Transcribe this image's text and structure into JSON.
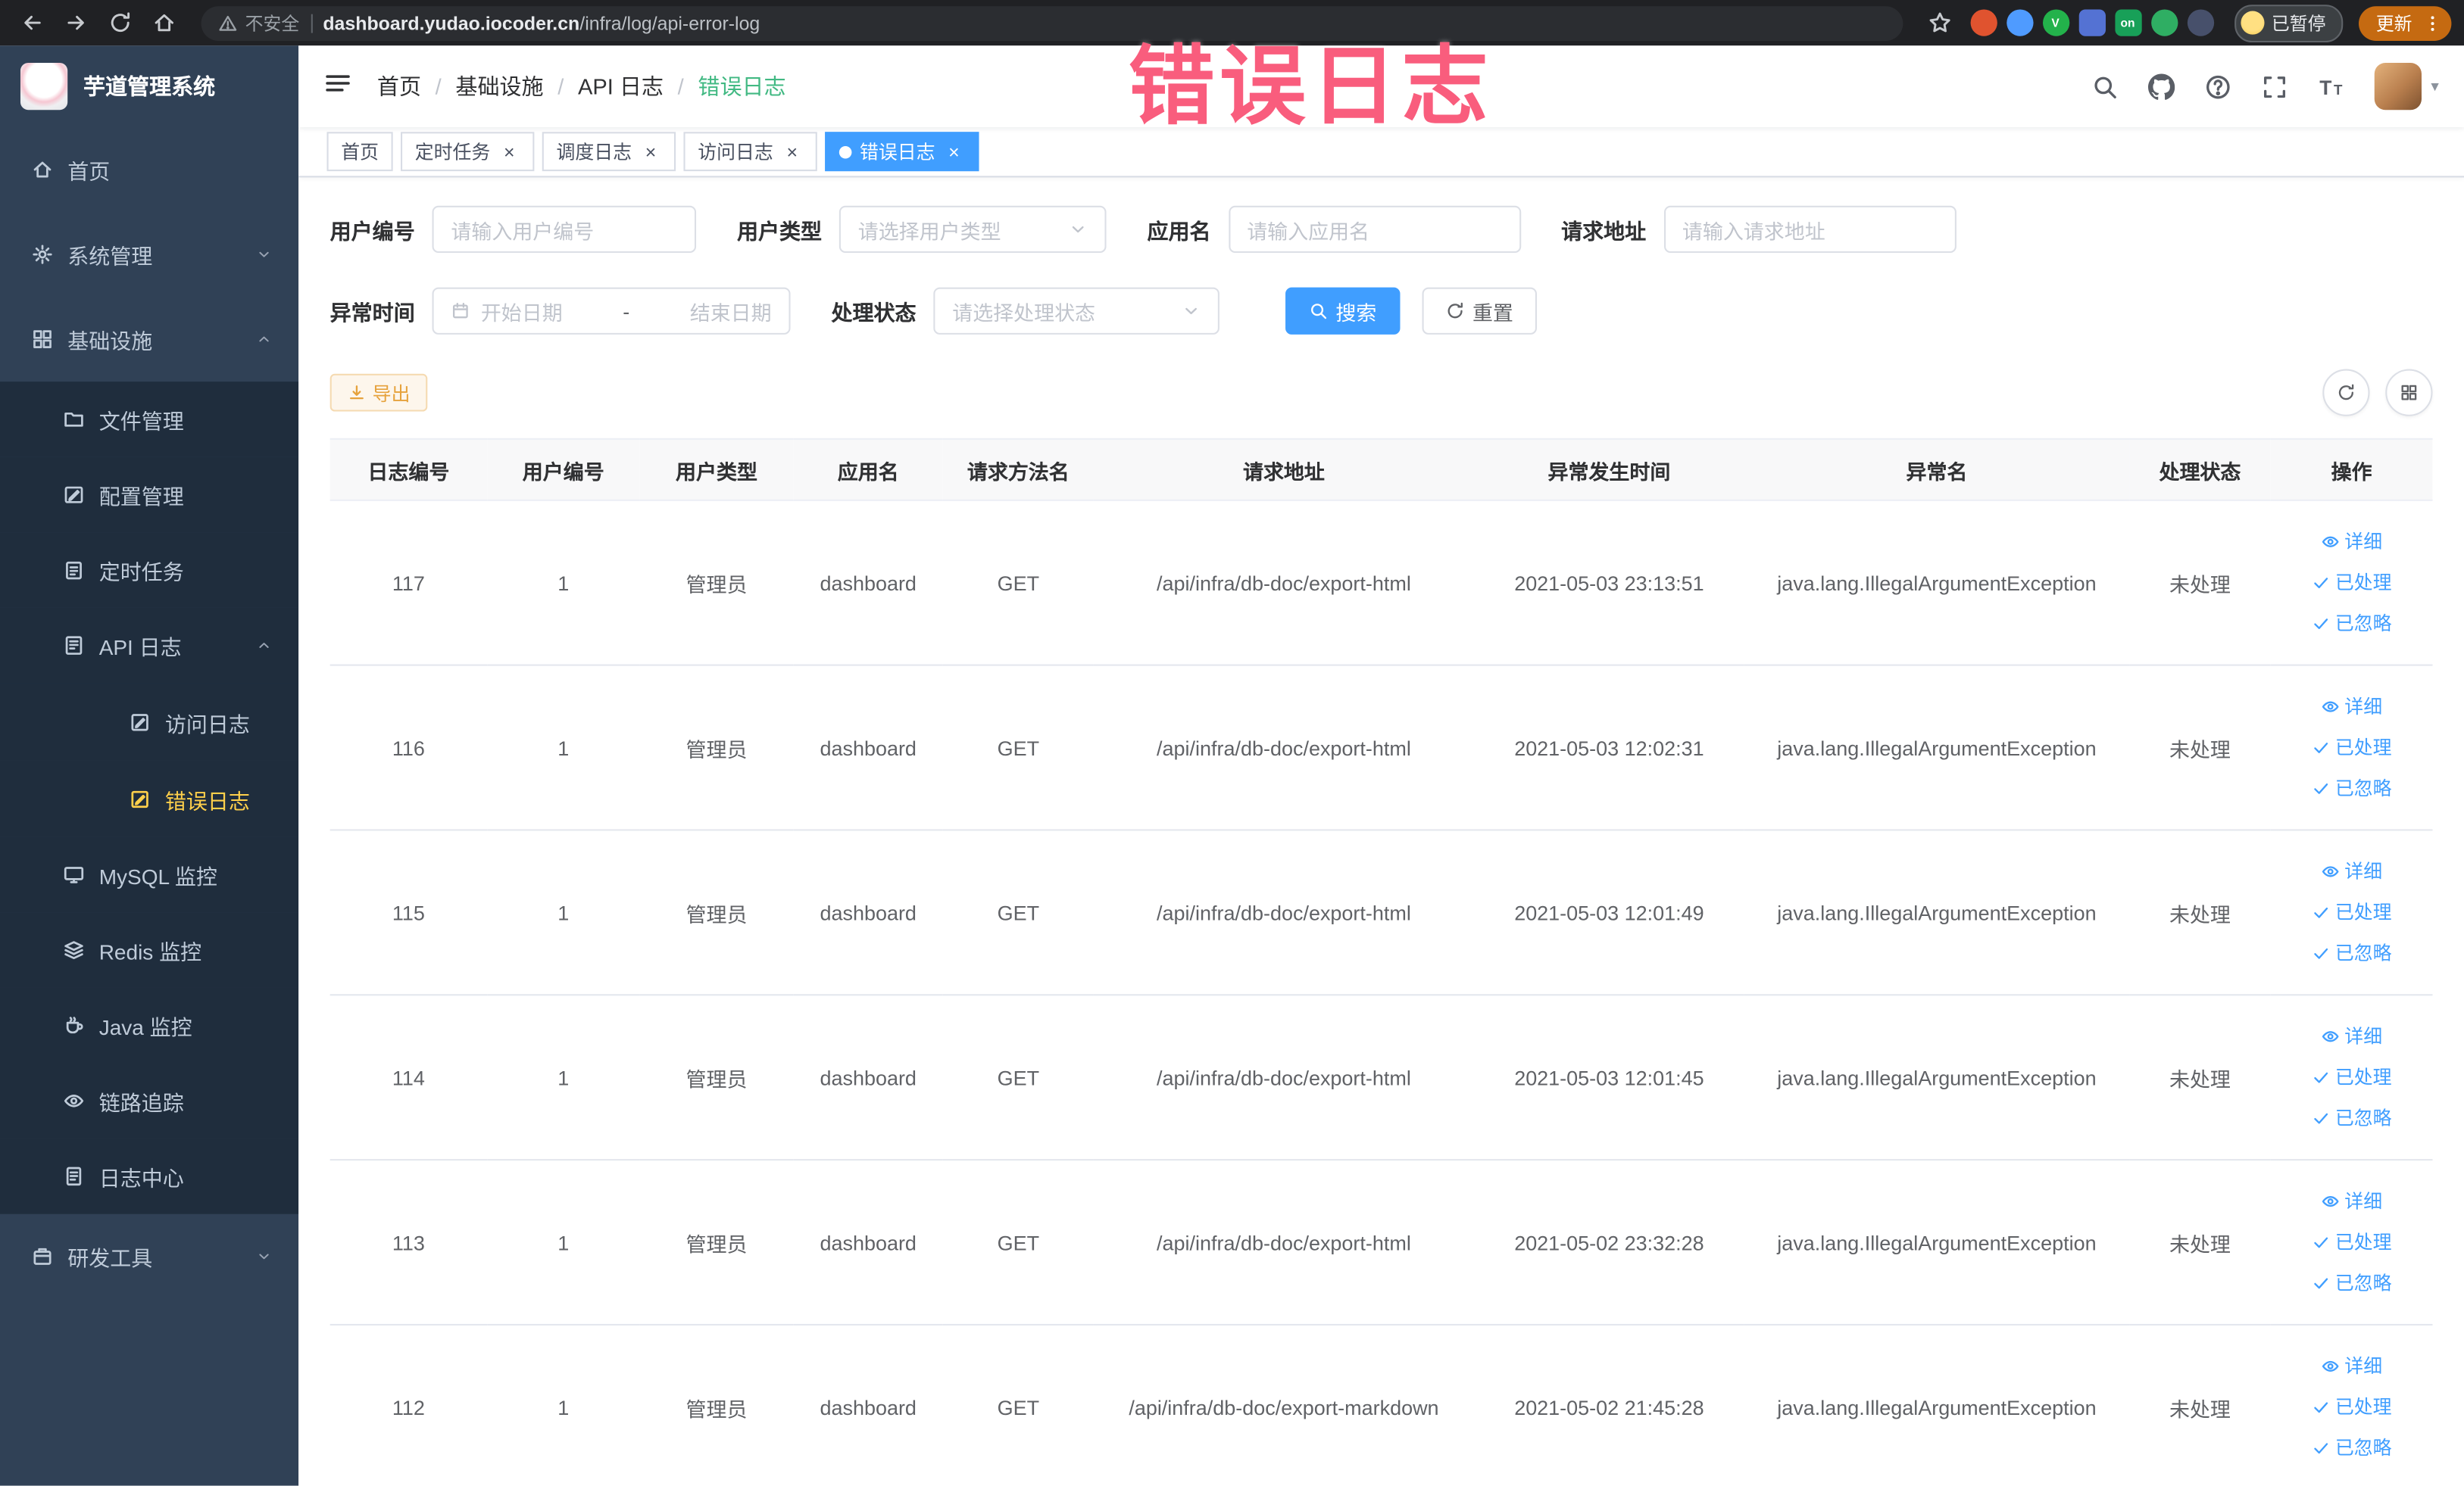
{
  "theme": {
    "primary": "#409EFF",
    "warning": "#E6A23C",
    "sidebar_bg": "#304156",
    "sidebar_sub_bg": "#1f2d3d",
    "sidebar_text": "#bfcbd9",
    "sidebar_active_text": "#ffd04b",
    "breadcrumb_active": "#42b983",
    "overlay_pink": "#f95d7d"
  },
  "browser": {
    "security_label": "不安全",
    "url_domain": "dashboard.yudao.iocoder.cn",
    "url_path": "/infra/log/api-error-log",
    "profile_chip": "已暂停",
    "update_button": "更新",
    "extensions": [
      {
        "name": "adblock-extension-icon",
        "color": "#e0532f",
        "shape": "round",
        "text": ""
      },
      {
        "name": "water-drop-extension-icon",
        "color": "#4f9bff",
        "shape": "round",
        "text": ""
      },
      {
        "name": "v-green-extension-icon",
        "color": "#23b24b",
        "shape": "round",
        "text": "V"
      },
      {
        "name": "grid-extension-icon",
        "color": "#5472d3",
        "shape": "sq",
        "text": ""
      },
      {
        "name": "on-badge-extension-icon",
        "color": "#18a058",
        "shape": "sq",
        "text": "on"
      },
      {
        "name": "leaf-extension-icon",
        "color": "#2fae63",
        "shape": "round",
        "text": ""
      },
      {
        "name": "paw-extension-icon",
        "color": "#47506b",
        "shape": "round",
        "text": ""
      }
    ]
  },
  "overlay": {
    "text": "错误日志"
  },
  "sidebar": {
    "logo_title": "芋道管理系统",
    "items": [
      {
        "label": "首页",
        "icon": "home",
        "level": 1
      },
      {
        "label": "系统管理",
        "icon": "gear",
        "level": 1,
        "arrow": "chev-down"
      },
      {
        "label": "基础设施",
        "icon": "infra",
        "level": 1,
        "arrow": "chev-up"
      },
      {
        "label": "文件管理",
        "icon": "file",
        "level": 2
      },
      {
        "label": "配置管理",
        "icon": "config",
        "level": 2
      },
      {
        "label": "定时任务",
        "icon": "task",
        "level": 2
      },
      {
        "label": "API 日志",
        "icon": "apilog",
        "level": 2,
        "arrow": "chev-up"
      },
      {
        "label": "访问日志",
        "icon": "editdoc",
        "level": 3
      },
      {
        "label": "错误日志",
        "icon": "editdoc",
        "level": 3,
        "active": true
      },
      {
        "label": "MySQL 监控",
        "icon": "monitor",
        "level": 2
      },
      {
        "label": "Redis 监控",
        "icon": "redis",
        "level": 2
      },
      {
        "label": "Java 监控",
        "icon": "java",
        "level": 2
      },
      {
        "label": "链路追踪",
        "icon": "trace",
        "level": 2
      },
      {
        "label": "日志中心",
        "icon": "doc",
        "level": 2
      },
      {
        "label": "研发工具",
        "icon": "devtools",
        "level": 1,
        "arrow": "chev-down"
      }
    ]
  },
  "header": {
    "breadcrumb": [
      "首页",
      "基础设施",
      "API 日志",
      "错误日志"
    ],
    "separator": "/"
  },
  "tabs": [
    {
      "label": "首页",
      "closable": false,
      "active": false
    },
    {
      "label": "定时任务",
      "closable": true,
      "active": false
    },
    {
      "label": "调度日志",
      "closable": true,
      "active": false
    },
    {
      "label": "访问日志",
      "closable": true,
      "active": false
    },
    {
      "label": "错误日志",
      "closable": true,
      "active": true
    }
  ],
  "filters": {
    "user_id": {
      "label": "用户编号",
      "placeholder": "请输入用户编号"
    },
    "user_type": {
      "label": "用户类型",
      "placeholder": "请选择用户类型"
    },
    "app_name": {
      "label": "应用名",
      "placeholder": "请输入应用名"
    },
    "request_url": {
      "label": "请求地址",
      "placeholder": "请输入请求地址"
    },
    "exception_time": {
      "label": "异常时间",
      "start_placeholder": "开始日期",
      "separator": "-",
      "end_placeholder": "结束日期"
    },
    "process_status": {
      "label": "处理状态",
      "placeholder": "请选择处理状态"
    },
    "search_button": "搜索",
    "reset_button": "重置"
  },
  "toolbar": {
    "export_button": "导出"
  },
  "table": {
    "headers": [
      "日志编号",
      "用户编号",
      "用户类型",
      "应用名",
      "请求方法名",
      "请求地址",
      "异常发生时间",
      "异常名",
      "处理状态",
      "操作"
    ],
    "action_labels": [
      "详细",
      "已处理",
      "已忽略"
    ],
    "rows": [
      {
        "log_id": "117",
        "user_id": "1",
        "user_type": "管理员",
        "app_name": "dashboard",
        "method": "GET",
        "url": "/api/infra/db-doc/export-html",
        "time": "2021-05-03 23:13:51",
        "exception": "java.lang.IllegalArgumentException",
        "status": "未处理"
      },
      {
        "log_id": "116",
        "user_id": "1",
        "user_type": "管理员",
        "app_name": "dashboard",
        "method": "GET",
        "url": "/api/infra/db-doc/export-html",
        "time": "2021-05-03 12:02:31",
        "exception": "java.lang.IllegalArgumentException",
        "status": "未处理"
      },
      {
        "log_id": "115",
        "user_id": "1",
        "user_type": "管理员",
        "app_name": "dashboard",
        "method": "GET",
        "url": "/api/infra/db-doc/export-html",
        "time": "2021-05-03 12:01:49",
        "exception": "java.lang.IllegalArgumentException",
        "status": "未处理"
      },
      {
        "log_id": "114",
        "user_id": "1",
        "user_type": "管理员",
        "app_name": "dashboard",
        "method": "GET",
        "url": "/api/infra/db-doc/export-html",
        "time": "2021-05-03 12:01:45",
        "exception": "java.lang.IllegalArgumentException",
        "status": "未处理"
      },
      {
        "log_id": "113",
        "user_id": "1",
        "user_type": "管理员",
        "app_name": "dashboard",
        "method": "GET",
        "url": "/api/infra/db-doc/export-html",
        "time": "2021-05-02 23:32:28",
        "exception": "java.lang.IllegalArgumentException",
        "status": "未处理"
      },
      {
        "log_id": "112",
        "user_id": "1",
        "user_type": "管理员",
        "app_name": "dashboard",
        "method": "GET",
        "url": "/api/infra/db-doc/export-markdown",
        "time": "2021-05-02 21:45:28",
        "exception": "java.lang.IllegalArgumentException",
        "status": "未处理"
      }
    ]
  }
}
